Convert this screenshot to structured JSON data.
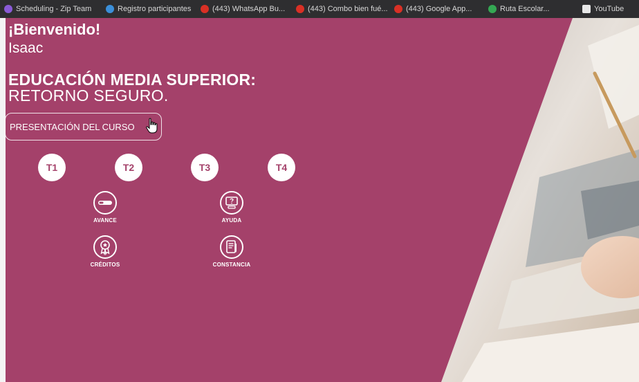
{
  "bookmarks": [
    {
      "label": "Scheduling - Zip Team",
      "color": "#8a5bd6"
    },
    {
      "label": "Registro participantes",
      "color": "#3b8fd9"
    },
    {
      "label": "(443) WhatsApp Bu...",
      "color": "#d93025"
    },
    {
      "label": "(443) Combo bien fué...",
      "color": "#d93025"
    },
    {
      "label": "(443) Google App...",
      "color": "#d93025"
    },
    {
      "label": "Ruta Escolar...",
      "color": "#34a853"
    },
    {
      "label": "YouTube",
      "color": "#e8e8e8"
    }
  ],
  "header": {
    "welcome": "¡Bienvenido!",
    "username": "Isaac"
  },
  "course": {
    "title": "EDUCACIÓN MEDIA SUPERIOR:",
    "subtitle": "RETORNO SEGURO."
  },
  "presentation_button": "PRESENTACIÓN DEL CURSO",
  "topics": [
    "T1",
    "T2",
    "T3",
    "T4"
  ],
  "tools": {
    "avance": "AVANCE",
    "ayuda": "AYUDA",
    "creditos": "CRÉDITOS",
    "constancia": "CONSTANCIA"
  },
  "colors": {
    "panel": "#a4416a",
    "topic_text": "#a4416a",
    "bookmarks_bar": "#2e2e30"
  }
}
